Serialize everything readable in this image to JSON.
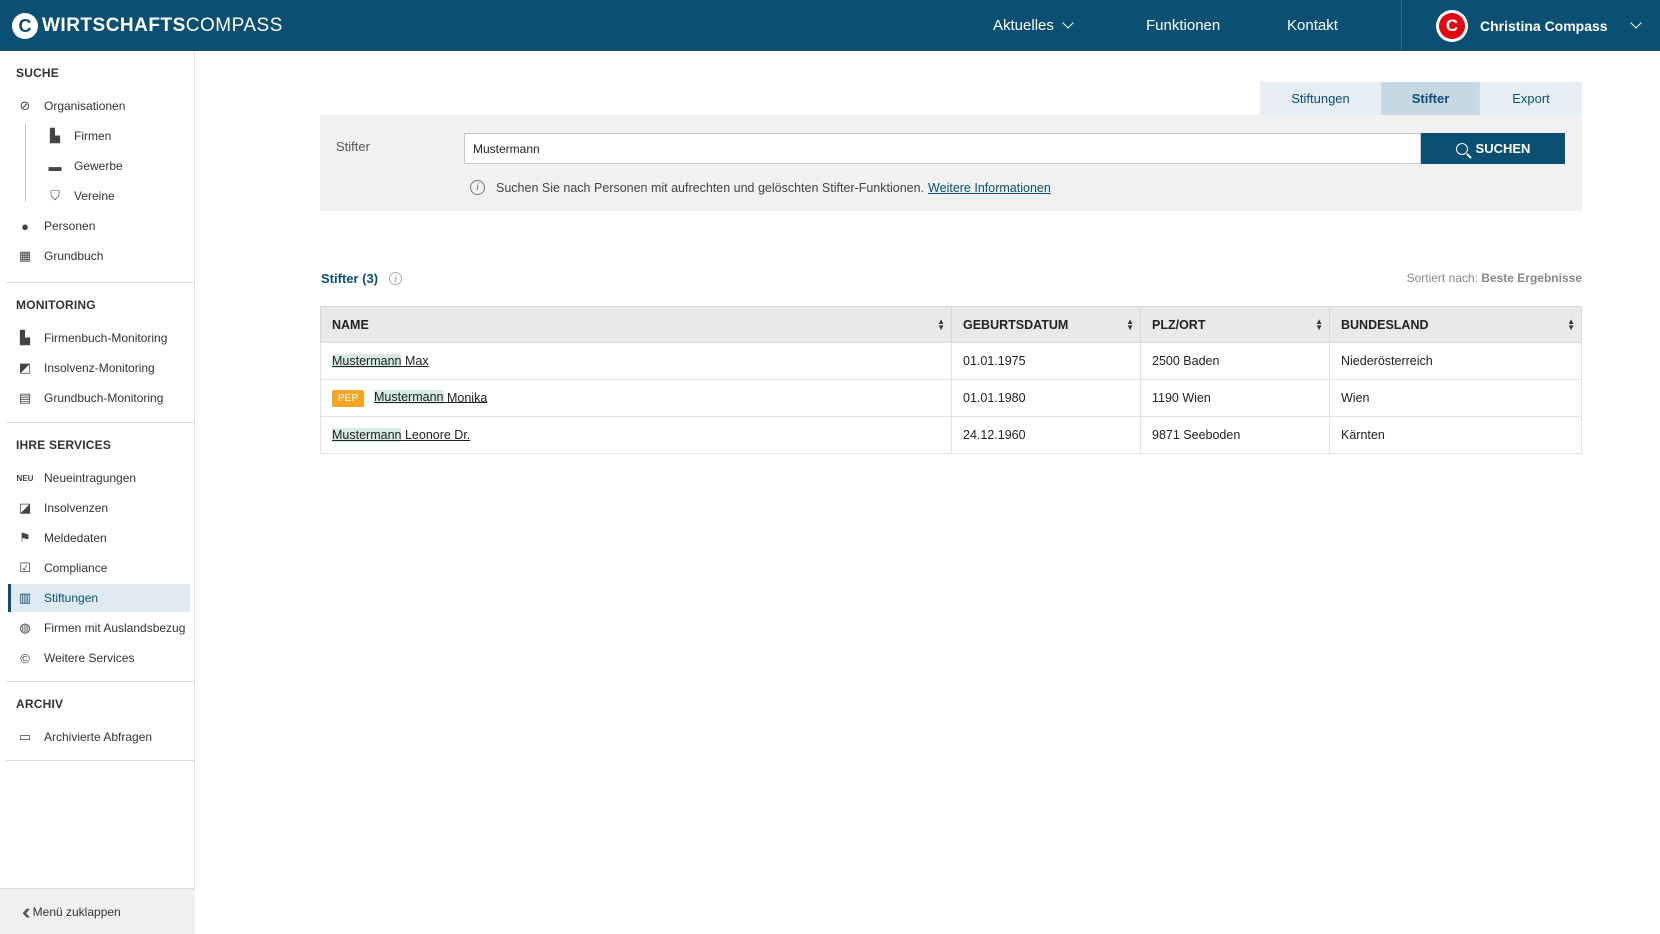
{
  "header": {
    "logo_bold": "WIRTSCHAFTS",
    "logo_light": "COMPASS",
    "logo_mark": "C",
    "nav": [
      {
        "label": "Aktuelles",
        "has_dropdown": true
      },
      {
        "label": "Funktionen"
      },
      {
        "label": "Kontakt"
      }
    ],
    "user_name": "Christina Compass",
    "avatar_letter": "C"
  },
  "sidebar": {
    "sections": [
      {
        "title": "SUCHE"
      },
      {
        "title": "MONITORING"
      },
      {
        "title": "IHRE SERVICES"
      },
      {
        "title": "ARCHIV"
      }
    ],
    "suche": [
      {
        "label": "Organisationen",
        "icon": "compass-icon"
      },
      {
        "label": "Firmen",
        "icon": "factory-icon"
      },
      {
        "label": "Gewerbe",
        "icon": "briefcase-icon"
      },
      {
        "label": "Vereine",
        "icon": "shield-icon"
      },
      {
        "label": "Personen",
        "icon": "person-icon"
      },
      {
        "label": "Grundbuch",
        "icon": "book-icon"
      }
    ],
    "monitoring": [
      {
        "label": "Firmenbuch-Monitoring",
        "icon": "factory-plus-icon"
      },
      {
        "label": "Insolvenz-Monitoring",
        "icon": "chart-plus-icon"
      },
      {
        "label": "Grundbuch-Monitoring",
        "icon": "building-plus-icon"
      }
    ],
    "services": [
      {
        "label": "Neueintragungen",
        "icon": "new-badge-icon",
        "icon_text": "NEU"
      },
      {
        "label": "Insolvenzen",
        "icon": "chart-down-icon"
      },
      {
        "label": "Meldedaten",
        "icon": "flag-icon"
      },
      {
        "label": "Compliance",
        "icon": "checkbox-icon"
      },
      {
        "label": "Stiftungen",
        "icon": "institution-icon",
        "active": true
      },
      {
        "label": "Firmen mit Auslandsbezug",
        "icon": "globe-icon"
      },
      {
        "label": "Weitere Services",
        "icon": "compass-c-icon"
      }
    ],
    "archiv": [
      {
        "label": "Archivierte Abfragen",
        "icon": "archive-icon"
      }
    ],
    "collapse_label": "Menü zuklappen"
  },
  "tabs": [
    {
      "label": "Stiftungen"
    },
    {
      "label": "Stifter",
      "active": true
    },
    {
      "label": "Export"
    }
  ],
  "search": {
    "label": "Stifter",
    "value": "Mustermann",
    "button_label": "SUCHEN",
    "hint": "Suchen Sie nach Personen mit aufrechten und gelöschten Stifter-Funktionen.",
    "hint_link": "Weitere Informationen"
  },
  "results": {
    "title": "Stifter (3)",
    "sort_prefix": "Sortiert nach:",
    "sort_value": "Beste Ergebnisse",
    "columns": [
      "NAME",
      "GEBURTSDATUM",
      "PLZ/ORT",
      "BUNDESLAND"
    ],
    "rows": [
      {
        "name_hl": "Mustermann",
        "name_rest": " Max",
        "pep": "",
        "birth": "01.01.1975",
        "place": "2500 Baden",
        "state": "Niederösterreich"
      },
      {
        "name_hl": "Mustermann",
        "name_rest": " Monika",
        "pep": "PEP",
        "birth": "01.01.1980",
        "place": "1190 Wien",
        "state": "Wien"
      },
      {
        "name_hl": "Mustermann",
        "name_rest": " Leonore Dr.",
        "pep": "",
        "birth": "24.12.1960",
        "place": "9871 Seeboden",
        "state": "Kärnten"
      }
    ]
  },
  "colors": {
    "brand": "#0b4f72",
    "pep": "#f5a623",
    "highlight": "#d6ebe2"
  }
}
